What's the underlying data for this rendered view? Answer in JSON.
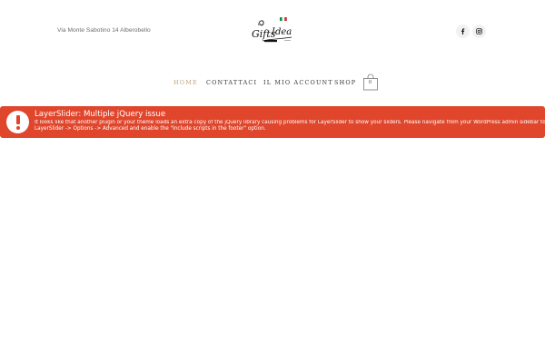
{
  "header": {
    "address": "Via Monte Sabotino 14 Alberobello",
    "logo": {
      "text": "Gifts Idea",
      "flag_colors": [
        "#009246",
        "#ffffff",
        "#ce2b37"
      ]
    },
    "social": [
      {
        "icon": "facebook-icon"
      },
      {
        "icon": "instagram-icon"
      }
    ]
  },
  "nav": {
    "items": [
      {
        "label": "HOME",
        "active": true
      },
      {
        "label": "CONTATTACI",
        "active": false
      },
      {
        "label": "IL MIO ACCOUNT",
        "active": false
      },
      {
        "label": "SHOP",
        "active": false
      }
    ],
    "cart_count": "0"
  },
  "notice": {
    "title": "LayerSlider: Multiple jQuery issue",
    "line1": "It looks like that another plugin or your theme loads an extra copy of the jQuery library causing problems for LayerSlider to show your sliders. Please navigate from your WordPress admin sidebar to",
    "line2": "LayerSlider -> Options -> Advanced and enable the \"Include scripts in the footer\" option.",
    "color": "#e0462c"
  },
  "colors": {
    "accent": "#bca27d",
    "nav_text": "#333333",
    "notice_bg": "#e0462c"
  }
}
